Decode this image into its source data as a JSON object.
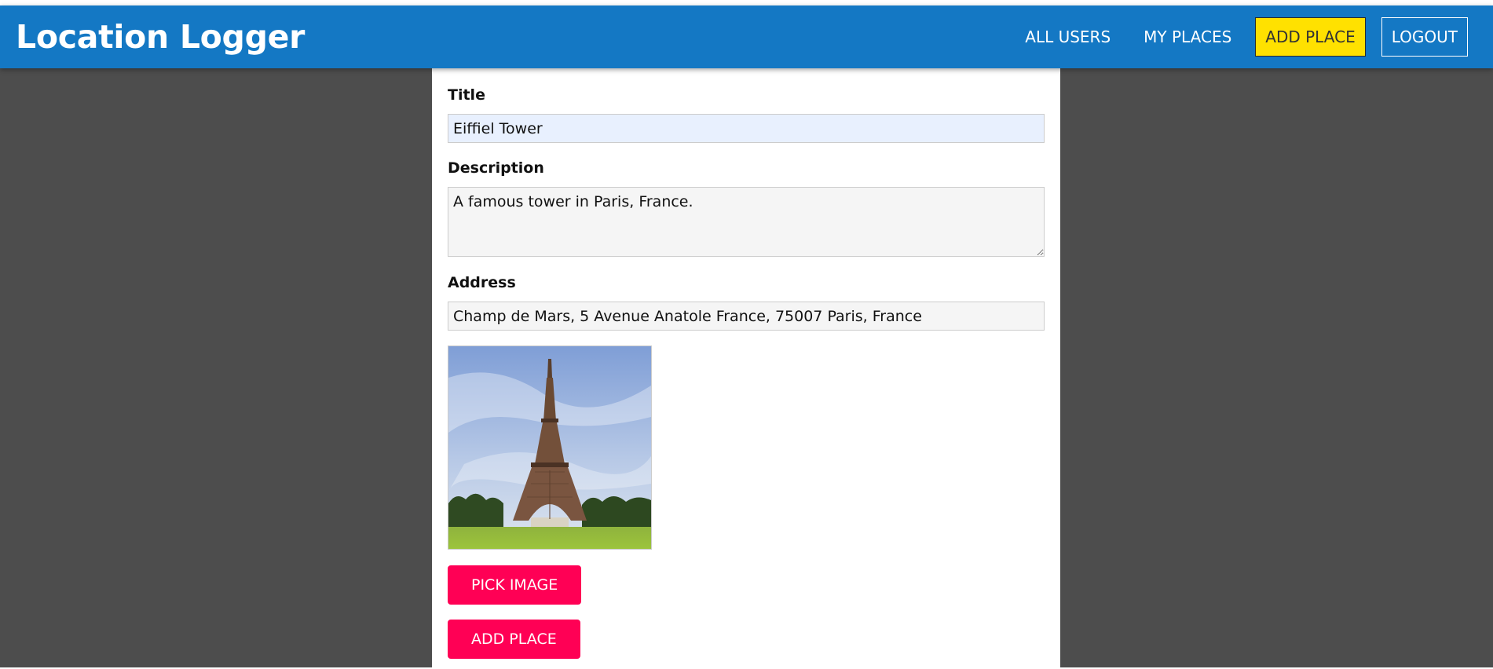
{
  "app": {
    "title": "Location Logger"
  },
  "nav": {
    "items": [
      {
        "label": "ALL USERS",
        "active": false
      },
      {
        "label": "MY PLACES",
        "active": false
      },
      {
        "label": "ADD PLACE",
        "active": true
      },
      {
        "label": "LOGOUT",
        "active": false
      }
    ]
  },
  "form": {
    "title_label": "Title",
    "title_value": "Eiffiel Tower",
    "description_label": "Description",
    "description_value": "A famous tower in Paris, France.",
    "address_label": "Address",
    "address_value": "Champ de Mars, 5 Avenue Anatole France, 75007 Paris, France",
    "image_preview": "eiffel-tower-photo",
    "pick_image_label": "PICK IMAGE",
    "submit_label": "ADD PLACE"
  },
  "colors": {
    "header": "#1478c4",
    "active_nav": "#ffe100",
    "button": "#ff0055",
    "backdrop": "#4d4d4d"
  }
}
